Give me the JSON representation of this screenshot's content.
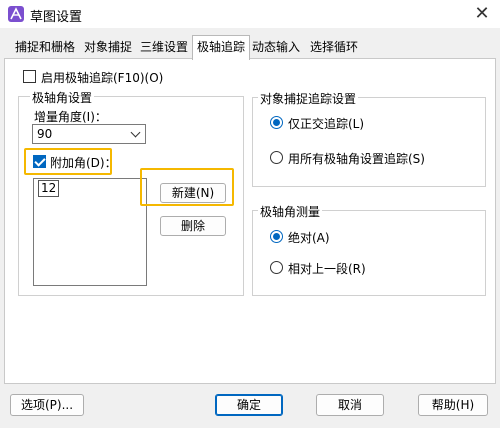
{
  "window": {
    "title": "草图设置",
    "close": "✕"
  },
  "tabs": [
    "捕捉和栅格",
    "对象捕捉",
    "三维设置",
    "极轴追踪",
    "动态输入",
    "选择循环"
  ],
  "enable_polar": {
    "label": "启用极轴追踪(F10)(O)",
    "checked": false
  },
  "polar_angle": {
    "group_title": "极轴角设置",
    "increment_label": "增量角度(I)：",
    "increment_value": "90",
    "additional_label": "附加角(D)：",
    "additional_checked": true,
    "angles": [
      "12"
    ],
    "new_button": "新建(N)",
    "delete_button": "删除"
  },
  "object_snap_tracking": {
    "group_title": "对象捕捉追踪设置",
    "options": [
      "仅正交追踪(L)",
      "用所有极轴角设置追踪(S)"
    ],
    "selected": 0
  },
  "polar_measurement": {
    "group_title": "极轴角测量",
    "options": [
      "绝对(A)",
      "相对上一段(R)"
    ],
    "selected": 0
  },
  "footer": {
    "options_button": "选项(P)...",
    "ok_button": "确定",
    "cancel_button": "取消",
    "help_button": "帮助(H)"
  },
  "colors": {
    "accent": "#0067c0",
    "highlight": "#f5b800",
    "app_icon": "#7b4fcf"
  }
}
